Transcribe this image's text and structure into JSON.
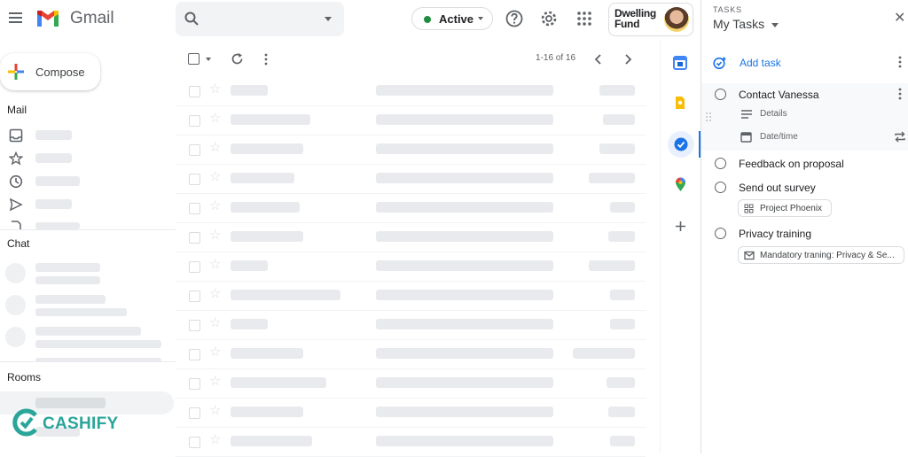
{
  "header": {
    "app_name": "Gmail",
    "status_label": "Active",
    "brand_line1": "Dwelling",
    "brand_line2": "Fund"
  },
  "sidebar": {
    "compose_label": "Compose",
    "mail_label": "Mail",
    "chat_label": "Chat",
    "rooms_label": "Rooms"
  },
  "toolbar": {
    "count_text": "1-16 of 16"
  },
  "tasks": {
    "caption": "TASKS",
    "list_name": "My Tasks",
    "add_task_label": "Add task",
    "items": [
      {
        "title": "Contact Vanessa",
        "details_label": "Details",
        "datetime_label": "Date/time"
      },
      {
        "title": "Feedback on proposal"
      },
      {
        "title": "Send out survey",
        "chip": "Project Phoenix"
      },
      {
        "title": "Privacy training",
        "chip": "Mandatory traning: Privacy & Se..."
      }
    ]
  },
  "watermark": {
    "text": "CASHIFY"
  },
  "colors": {
    "accent": "#1a73e8",
    "status_green": "#1e8e3e",
    "placeholder": "#e8eaed",
    "watermark": "#2aa59a"
  },
  "icons": [
    "menu-icon",
    "gmail-logo",
    "search-icon",
    "help-icon",
    "settings-icon",
    "apps-icon",
    "refresh-icon",
    "calendar-icon",
    "keep-icon",
    "tasks-icon",
    "maps-icon",
    "add-icon"
  ]
}
